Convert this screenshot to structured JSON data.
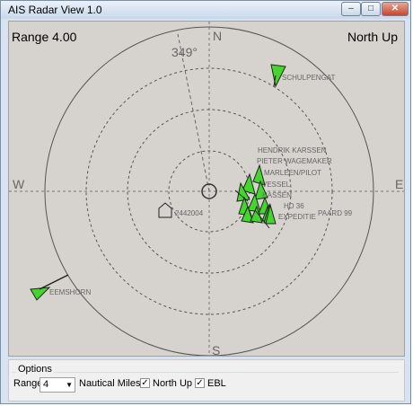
{
  "window": {
    "title": "AIS Radar View 1.0",
    "minimize": "–",
    "maximize": "□",
    "close": "✕"
  },
  "radar": {
    "range_text": "Range 4.00",
    "orientation_text": "North Up",
    "bearing_text": "349°",
    "compass": {
      "n": "N",
      "s": "S",
      "e": "E",
      "w": "W"
    },
    "targets": [
      {
        "label": "SCHULPENGAT"
      },
      {
        "label": "HENDRIK KARSSEN"
      },
      {
        "label": "PIETER WAGEMAKER"
      },
      {
        "label": "MARLEEN/PILOT"
      },
      {
        "label": "VESSEL"
      },
      {
        "label": "HASSEN"
      },
      {
        "label": "HD 36"
      },
      {
        "label": "EXPEDITIE"
      },
      {
        "label": "PAARD 99"
      },
      {
        "label": "2442004"
      },
      {
        "label": "EEMSHORN"
      }
    ]
  },
  "options": {
    "legend": "Options",
    "range_label": "Range",
    "range_value": "4",
    "unit_label": "Nautical Miles",
    "north_up_label": "North Up",
    "north_up_checked": "✓",
    "ebl_label": "EBL",
    "ebl_checked": "✓"
  },
  "colors": {
    "target_fill": "#44d62c",
    "radar_bg": "#d6d3ce",
    "ring": "#555555"
  }
}
